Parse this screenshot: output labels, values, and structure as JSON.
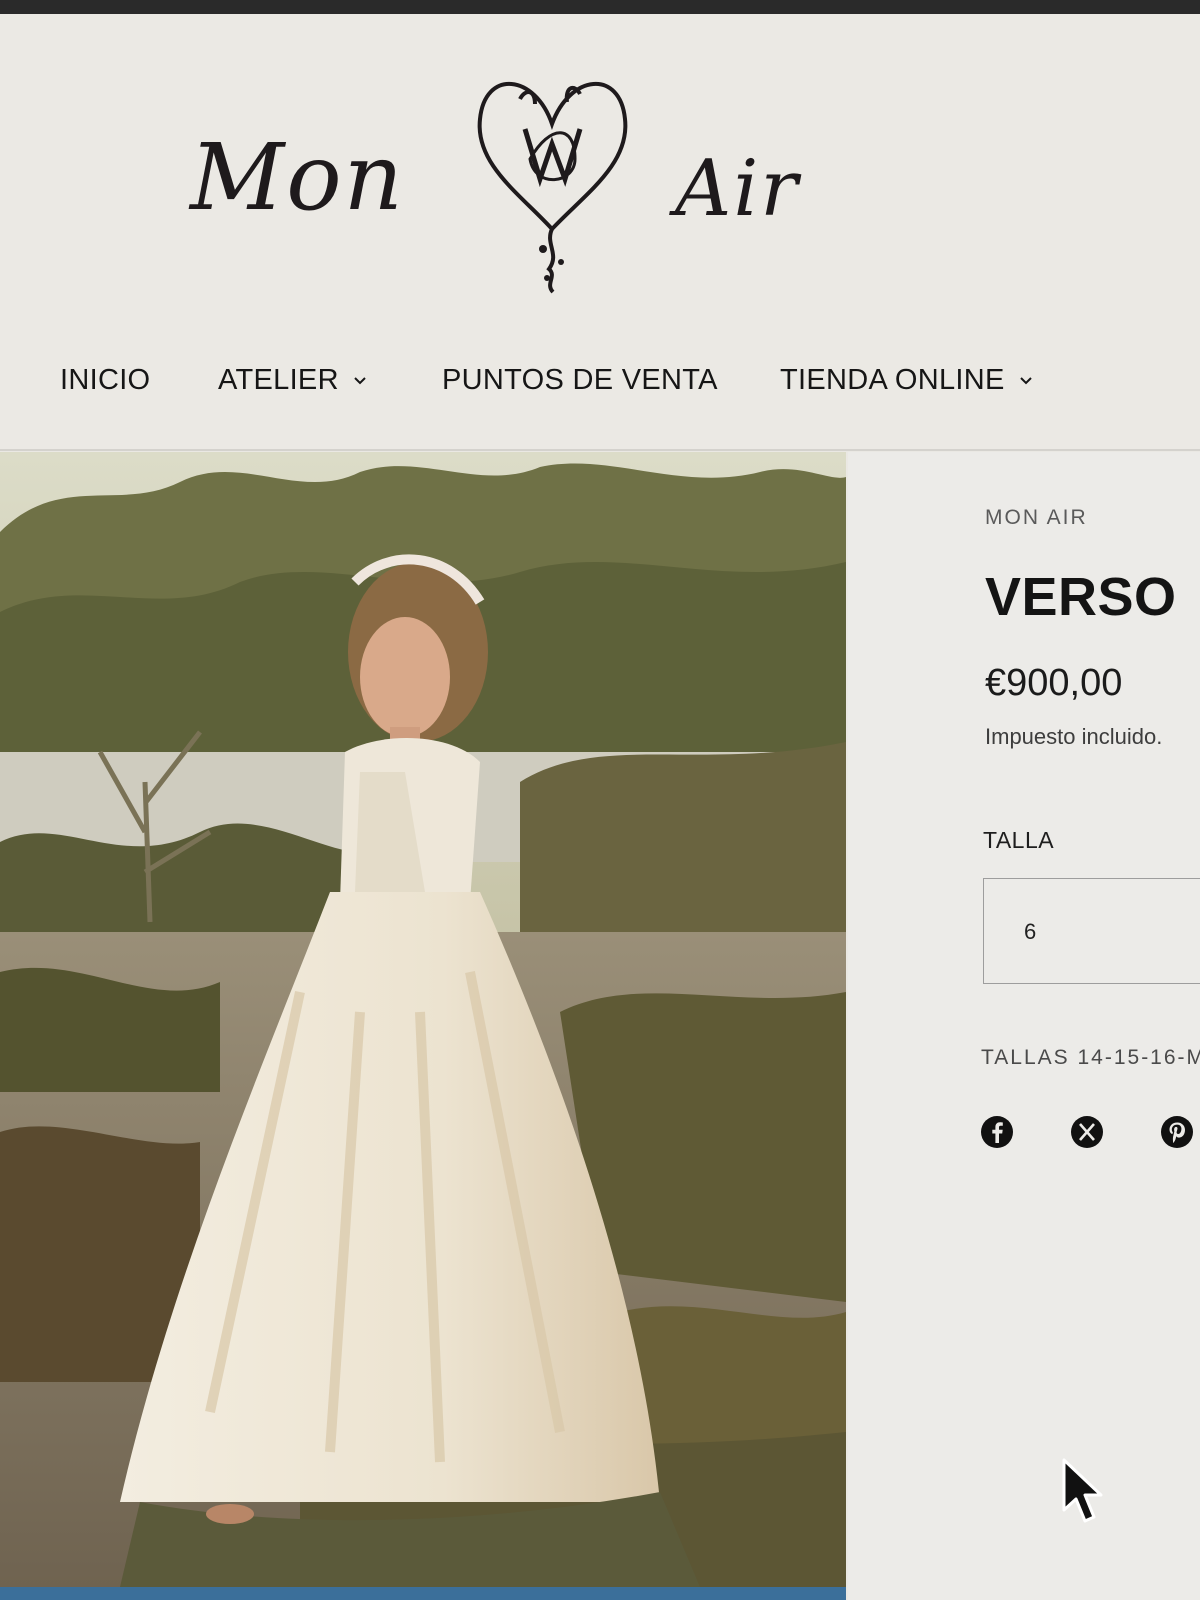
{
  "brand": {
    "logo_left": "Mon",
    "logo_right": "Air"
  },
  "nav": {
    "items": [
      {
        "label": "INICIO",
        "has_dropdown": false
      },
      {
        "label": "ATELIER",
        "has_dropdown": true
      },
      {
        "label": "PUNTOS DE VENTA",
        "has_dropdown": false
      },
      {
        "label": "TIENDA ONLINE",
        "has_dropdown": true
      }
    ]
  },
  "product": {
    "vendor": "MON AIR",
    "title": "VERSO",
    "price": "€900,00",
    "tax_note": "Impuesto incluido.",
    "size_label": "TALLA",
    "size_selected": "6",
    "sizes_note": "TALLAS 14-15-16-M"
  },
  "share": {
    "icons": [
      "facebook-icon",
      "x-icon",
      "pinterest-icon"
    ]
  },
  "colors": {
    "header_bg": "#ebe9e4",
    "panel_bg": "#ecebe8",
    "text_dark": "#141414"
  }
}
